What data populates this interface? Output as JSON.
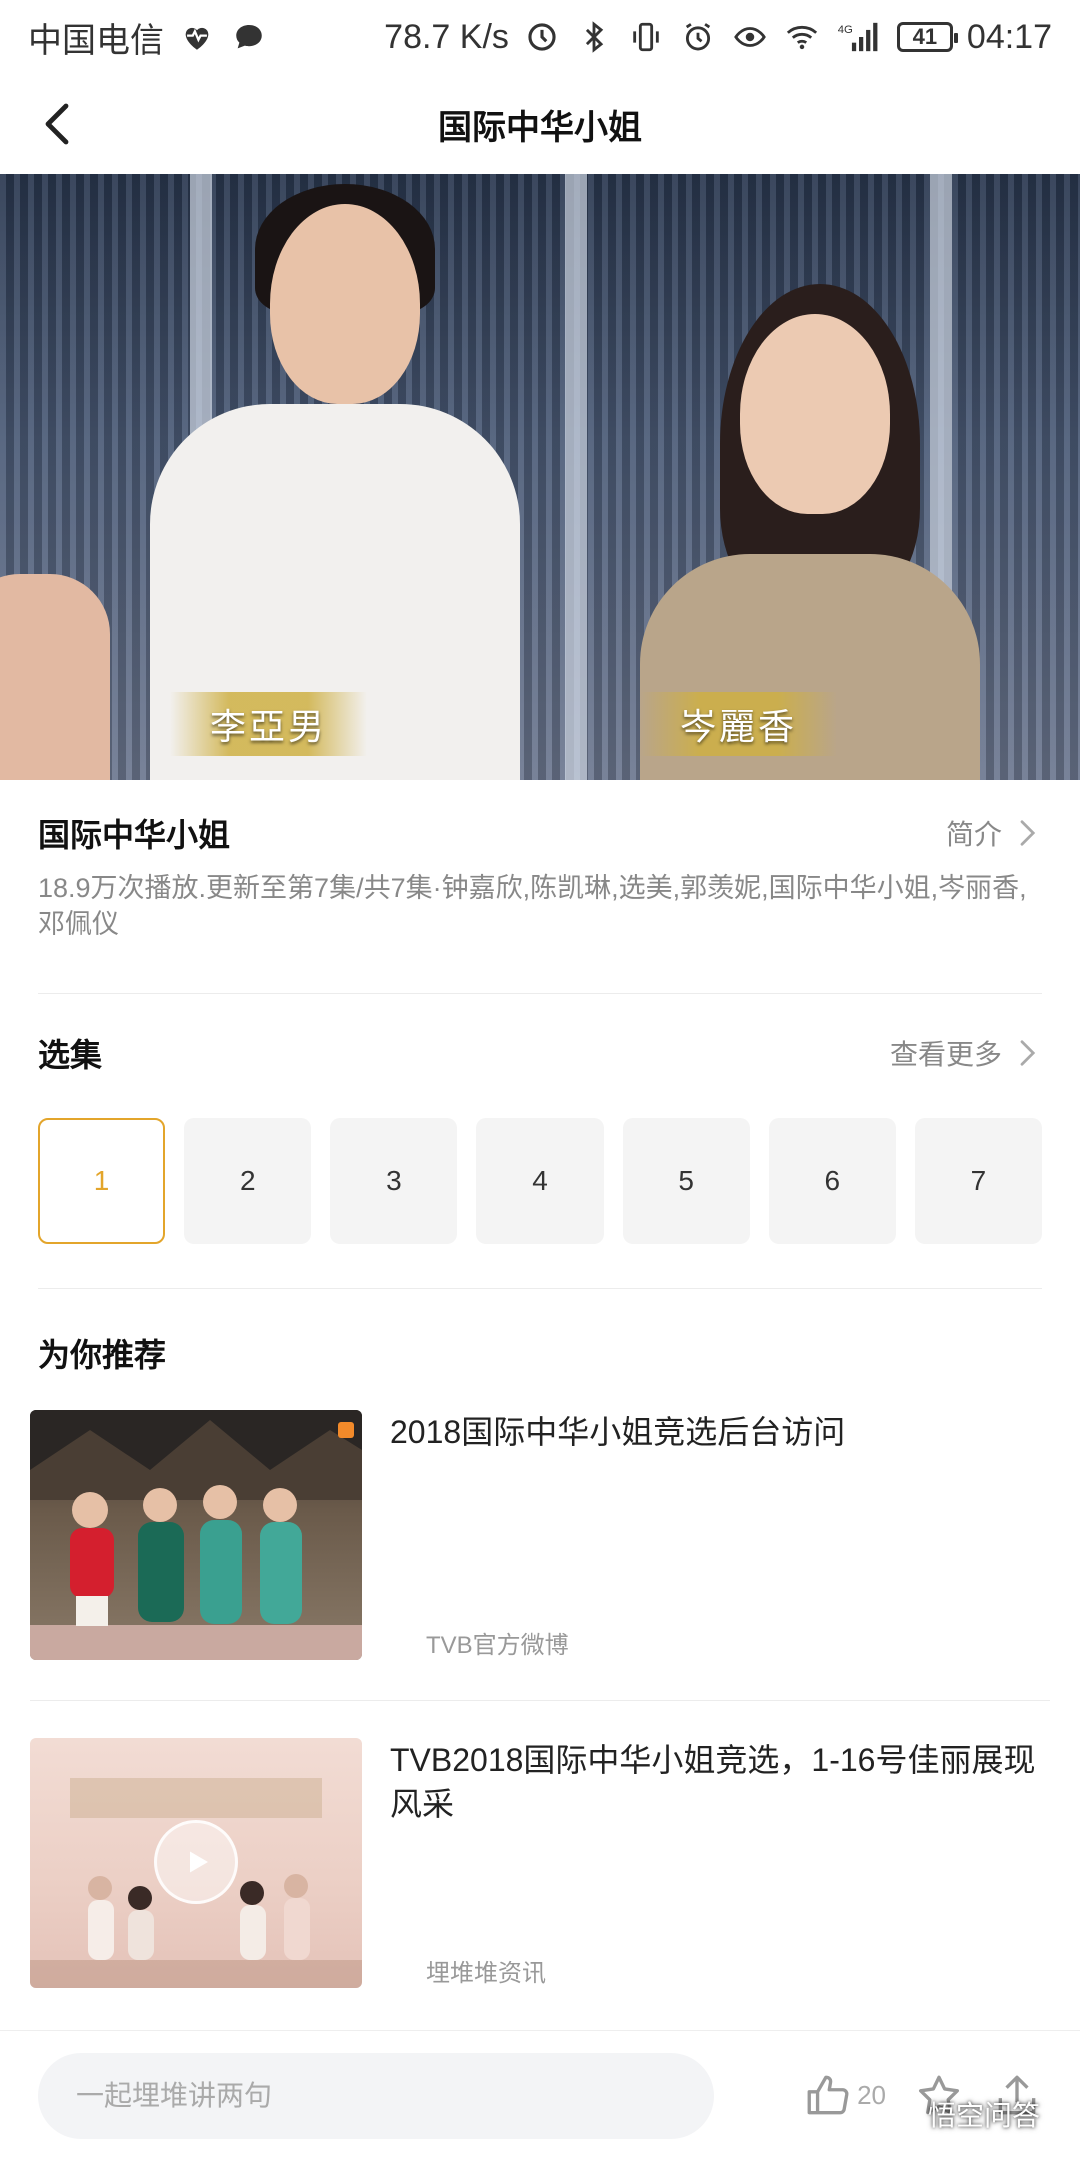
{
  "status_bar": {
    "carrier": "中国电信",
    "speed": "78.7 K/s",
    "network": "4G",
    "battery": "41",
    "time": "04:17",
    "icons": [
      "heartbeat-icon",
      "chat-icon",
      "data-saver-icon",
      "bluetooth-icon",
      "vibrate-icon",
      "alarm-icon",
      "eye-icon",
      "wifi-icon",
      "signal-icon",
      "battery-icon"
    ]
  },
  "header": {
    "title": "国际中华小姐"
  },
  "video": {
    "caption_left": "李亞男",
    "caption_right": "岑麗香"
  },
  "info": {
    "title": "国际中华小姐",
    "intro_label": "简介",
    "meta": "18.9万次播放.更新至第7集/共7集·钟嘉欣,陈凯琳,选美,郭羡妮,国际中华小姐,岑丽香,邓佩仪"
  },
  "episodes": {
    "title": "选集",
    "more_label": "查看更多",
    "items": [
      "1",
      "2",
      "3",
      "4",
      "5",
      "6",
      "7"
    ],
    "selected": "1"
  },
  "recommend": {
    "title": "为你推荐",
    "items": [
      {
        "title": "2018国际中华小姐竞选后台访问",
        "source": "TVB官方微博"
      },
      {
        "title": "TVB2018国际中华小姐竞选，1-16号佳丽展现风采",
        "source": "埋堆堆资讯"
      }
    ]
  },
  "bottom_bar": {
    "placeholder": "一起埋堆讲两句",
    "likes": "20",
    "watermark": "悟空问答"
  },
  "colors": {
    "accent": "#e3a52b",
    "text_primary": "#111111",
    "text_secondary": "#888888"
  }
}
